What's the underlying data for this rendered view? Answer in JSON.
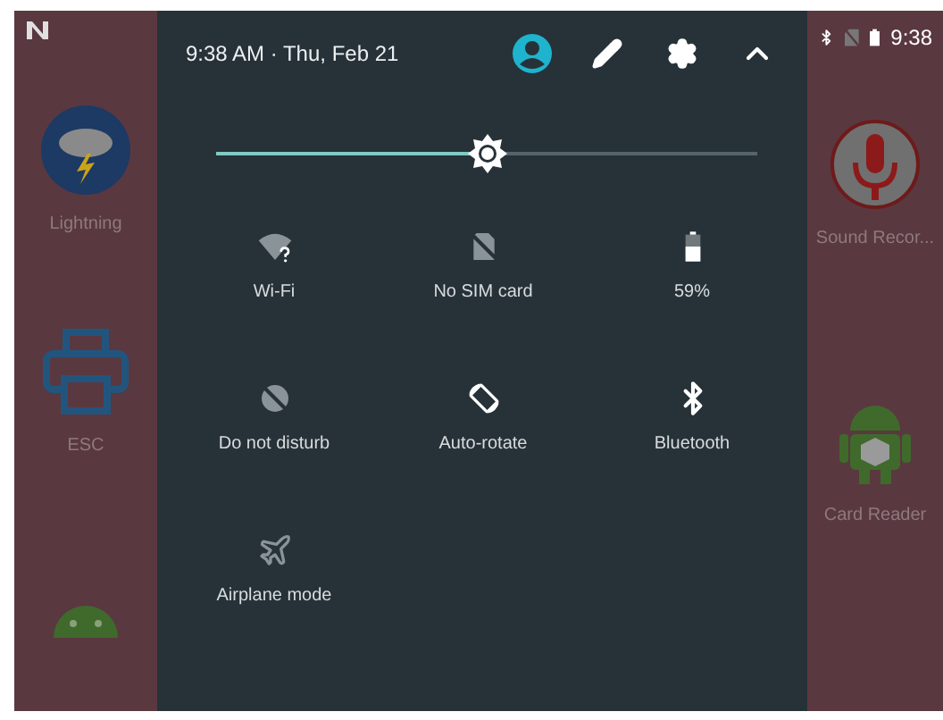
{
  "status_bar": {
    "time": "9:38"
  },
  "left_apps": [
    {
      "kind": "weather",
      "label": "Lightning"
    },
    {
      "kind": "printer",
      "label": "ESC"
    },
    {
      "kind": "android"
    }
  ],
  "right_apps": [
    {
      "kind": "mic",
      "label": "Sound Recor..."
    },
    {
      "kind": "android-box",
      "label": "Card Reader"
    }
  ],
  "header": {
    "datetime": "9:38 AM · Thu, Feb 21"
  },
  "brightness": {
    "level": 0.5
  },
  "tiles": [
    {
      "kind": "wifi",
      "label": "Wi-Fi",
      "on": false
    },
    {
      "kind": "sim",
      "label": "No SIM card",
      "on": false
    },
    {
      "kind": "battery",
      "label": "59%",
      "on": true
    },
    {
      "kind": "dnd",
      "label": "Do not disturb",
      "on": false
    },
    {
      "kind": "rotate",
      "label": "Auto-rotate",
      "on": true
    },
    {
      "kind": "bluetooth",
      "label": "Bluetooth",
      "on": true
    },
    {
      "kind": "airplane",
      "label": "Airplane mode",
      "on": false
    }
  ]
}
